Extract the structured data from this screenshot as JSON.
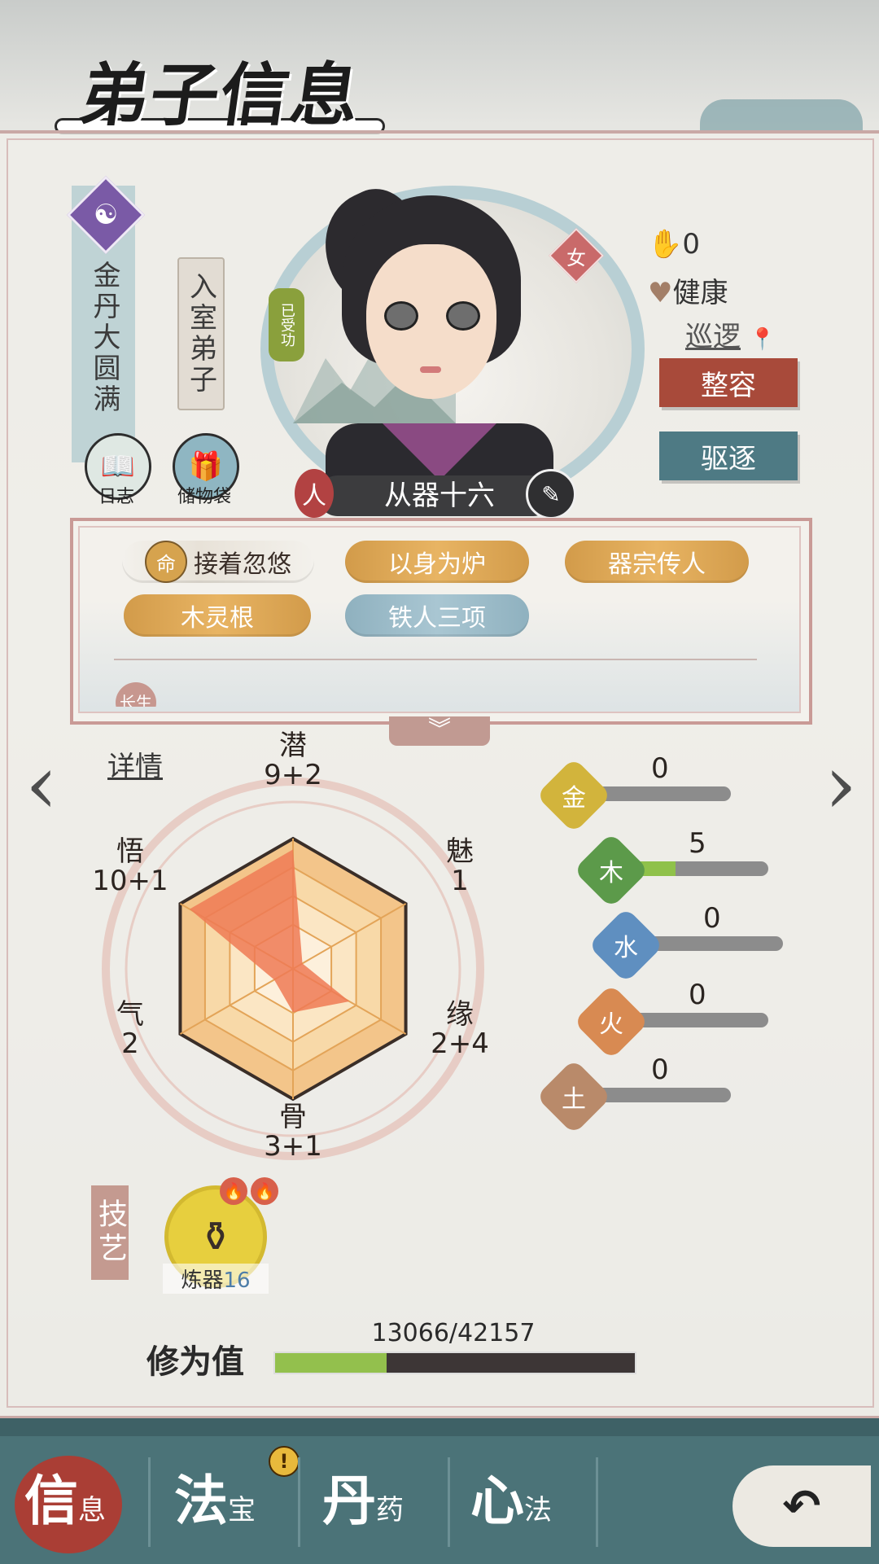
{
  "header": {
    "title": "弟子信息"
  },
  "rank": {
    "realm": "金丹大圆满",
    "role": "入室弟子"
  },
  "left_buttons": [
    {
      "label": "日志",
      "icon": "book-icon"
    },
    {
      "label": "储物袋",
      "icon": "bag-icon"
    }
  ],
  "portrait": {
    "gender": "女",
    "taught_badge": "已受功",
    "name": "从器十六",
    "name_left_glyph": "人",
    "name_right_glyph": "✎"
  },
  "status": {
    "count": "0",
    "health": "健康",
    "task": "巡逻",
    "actions": [
      {
        "label": "整容",
        "color": "#a84a3a"
      },
      {
        "label": "驱逐",
        "color": "#4e7a84"
      }
    ]
  },
  "traits": [
    {
      "label": "接着忽悠",
      "style": "plain",
      "badge": "命"
    },
    {
      "label": "以身为炉",
      "style": "orange"
    },
    {
      "label": "器宗传人",
      "style": "orange"
    },
    {
      "label": "木灵根",
      "style": "orange"
    },
    {
      "label": "铁人三项",
      "style": "blue"
    }
  ],
  "traits_more": {
    "partial_label": "长生"
  },
  "details_link": "详情",
  "radar": {
    "labels": [
      {
        "name": "潜",
        "value": "9+2"
      },
      {
        "name": "魅",
        "value": "1"
      },
      {
        "name": "缘",
        "value": "2+4"
      },
      {
        "name": "骨",
        "value": "3+1"
      },
      {
        "name": "气",
        "value": "2"
      },
      {
        "name": "悟",
        "value": "10+1"
      }
    ],
    "values": [
      11,
      1,
      6,
      4,
      2,
      11
    ],
    "max": 12
  },
  "elements": [
    {
      "name": "金",
      "value": "0",
      "fraction": 0.0,
      "color": "#d2b43c"
    },
    {
      "name": "木",
      "value": "5",
      "fraction": 0.35,
      "color": "#5c9a4a"
    },
    {
      "name": "水",
      "value": "0",
      "fraction": 0.0,
      "color": "#5f8fc0"
    },
    {
      "name": "火",
      "value": "0",
      "fraction": 0.0,
      "color": "#d88a52"
    },
    {
      "name": "土",
      "value": "0",
      "fraction": 0.0,
      "color": "#b98a6a"
    }
  ],
  "skills": {
    "section_label": "技艺",
    "items": [
      {
        "name": "炼器",
        "level": "16",
        "icon": "cauldron-icon"
      }
    ]
  },
  "cultivation": {
    "label": "修为值",
    "text": "13066/42157",
    "current": 13066,
    "max": 42157
  },
  "bottom_nav": [
    {
      "big": "信",
      "small": "息",
      "active": true
    },
    {
      "big": "法",
      "small": "宝",
      "alert": "!"
    },
    {
      "big": "丹",
      "small": "药"
    },
    {
      "big": "心",
      "small": "法"
    }
  ],
  "back_icon": "back-arrow-icon"
}
